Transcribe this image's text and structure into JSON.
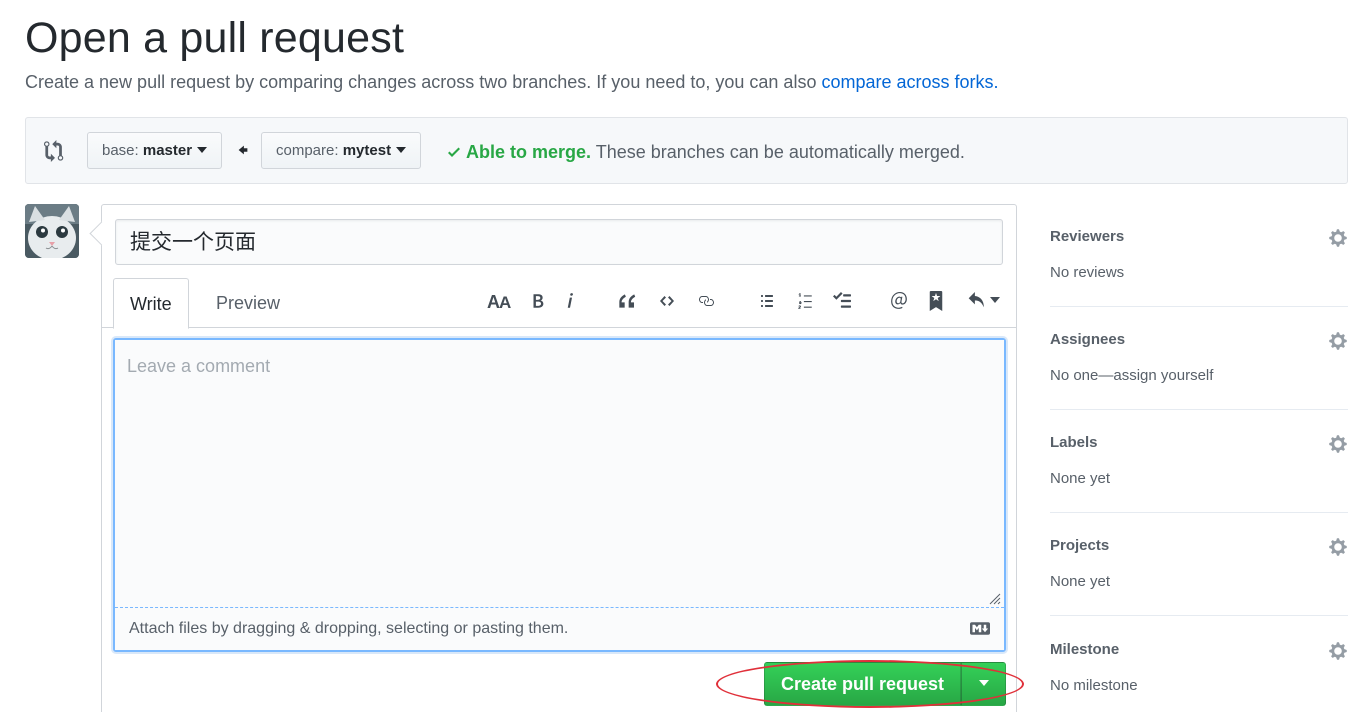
{
  "header": {
    "title": "Open a pull request",
    "subtitle": "Create a new pull request by comparing changes across two branches. If you need to, you can also ",
    "subtitle_link": "compare across forks."
  },
  "range": {
    "base_prefix": "base: ",
    "base_branch": "master",
    "compare_prefix": "compare: ",
    "compare_branch": "mytest",
    "merge_ok": "Able to merge.",
    "merge_text": " These branches can be automatically merged."
  },
  "form": {
    "title_value": "提交一个页面",
    "tabs": [
      {
        "label": "Write",
        "active": true
      },
      {
        "label": "Preview",
        "active": false
      }
    ],
    "toolbar_icons": [
      "header-icon",
      "bold-icon",
      "italic-icon",
      "quote-icon",
      "code-icon",
      "link-icon",
      "bulleted-list-icon",
      "numbered-list-icon",
      "task-list-icon",
      "mention-icon",
      "saved-reply-icon",
      "reply-dropdown-icon"
    ],
    "comment_placeholder": "Leave a comment",
    "attach_text": "Attach files by dragging & dropping, selecting or pasting them.",
    "submit_label": "Create pull request"
  },
  "sidebar": {
    "items": [
      {
        "heading": "Reviewers",
        "value": "No reviews"
      },
      {
        "heading": "Assignees",
        "value": "No one—assign yourself"
      },
      {
        "heading": "Labels",
        "value": "None yet"
      },
      {
        "heading": "Projects",
        "value": "None yet"
      },
      {
        "heading": "Milestone",
        "value": "No milestone"
      }
    ]
  },
  "colors": {
    "link": "#0366d6",
    "success": "#28a745",
    "focus_border": "#79b8ff",
    "annotation": "#e0303a"
  }
}
